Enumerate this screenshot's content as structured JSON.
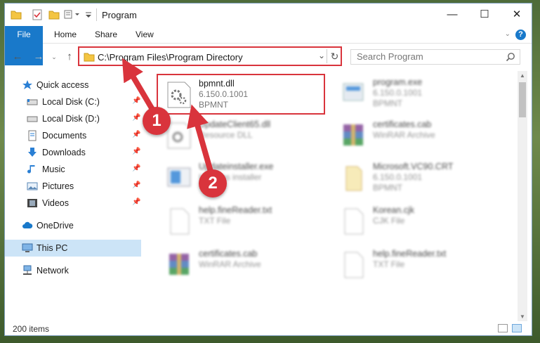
{
  "window": {
    "title": "Program",
    "minimize": "—",
    "maximize": "☐",
    "close": "✕"
  },
  "ribbon": {
    "tabs": [
      "File",
      "Home",
      "Share",
      "View"
    ],
    "help": "?"
  },
  "address": {
    "path": "C:\\Program Files\\Program Directory"
  },
  "search": {
    "placeholder": "Search Program"
  },
  "sidebar": {
    "items": [
      {
        "label": "Quick access",
        "icon": "star-icon"
      },
      {
        "label": "Local Disk (C:)",
        "icon": "drive-icon",
        "pinned": true
      },
      {
        "label": "Local Disk (D:)",
        "icon": "drive-icon",
        "pinned": true
      },
      {
        "label": "Documents",
        "icon": "documents-icon",
        "pinned": true
      },
      {
        "label": "Downloads",
        "icon": "download-icon",
        "pinned": true
      },
      {
        "label": "Music",
        "icon": "music-icon",
        "pinned": true
      },
      {
        "label": "Pictures",
        "icon": "pictures-icon",
        "pinned": true
      },
      {
        "label": "Videos",
        "icon": "videos-icon",
        "pinned": true
      },
      {
        "label": "OneDrive",
        "icon": "cloud-icon"
      },
      {
        "label": "This PC",
        "icon": "computer-icon",
        "selected": true
      },
      {
        "label": "Network",
        "icon": "network-icon"
      }
    ]
  },
  "files": [
    {
      "name": "bpmnt.dll",
      "line1": "6.150.0.1001",
      "line2": "BPMNT",
      "icon": "dll-gear-icon"
    },
    {
      "name": "program.exe",
      "line1": "6.150.0.1001",
      "line2": "BPMNT",
      "icon": "exe-icon"
    },
    {
      "name": "UpdateClient65.dll",
      "line1": "Resource DLL",
      "line2": "",
      "icon": "dll-gear-icon"
    },
    {
      "name": "certificates.cab",
      "line1": "WinRAR Archive",
      "line2": "",
      "icon": "winrar-icon"
    },
    {
      "name": "Updateinstaller.exe",
      "line1": "Updates installer",
      "line2": "",
      "icon": "installer-icon"
    },
    {
      "name": "Microsoft.VC90.CRT",
      "line1": "6.150.0.1001",
      "line2": "BPMNT",
      "icon": "folder-icon"
    },
    {
      "name": "help.fineReader.txt",
      "line1": "TXT File",
      "line2": "",
      "icon": "txt-icon"
    },
    {
      "name": "Korean.cjk",
      "line1": "CJK File",
      "line2": "",
      "icon": "txt-icon"
    },
    {
      "name": "certificates.cab",
      "line1": "WinRAR Archive",
      "line2": "",
      "icon": "winrar-icon"
    },
    {
      "name": "help.fineReader.txt",
      "line1": "TXT File",
      "line2": "",
      "icon": "txt-icon"
    }
  ],
  "status": {
    "item_count": "200 items"
  },
  "annotations": {
    "step1": "1",
    "step2": "2"
  },
  "colors": {
    "accent": "#1979ca",
    "highlight": "#d9343c",
    "selection": "#cce4f7"
  }
}
